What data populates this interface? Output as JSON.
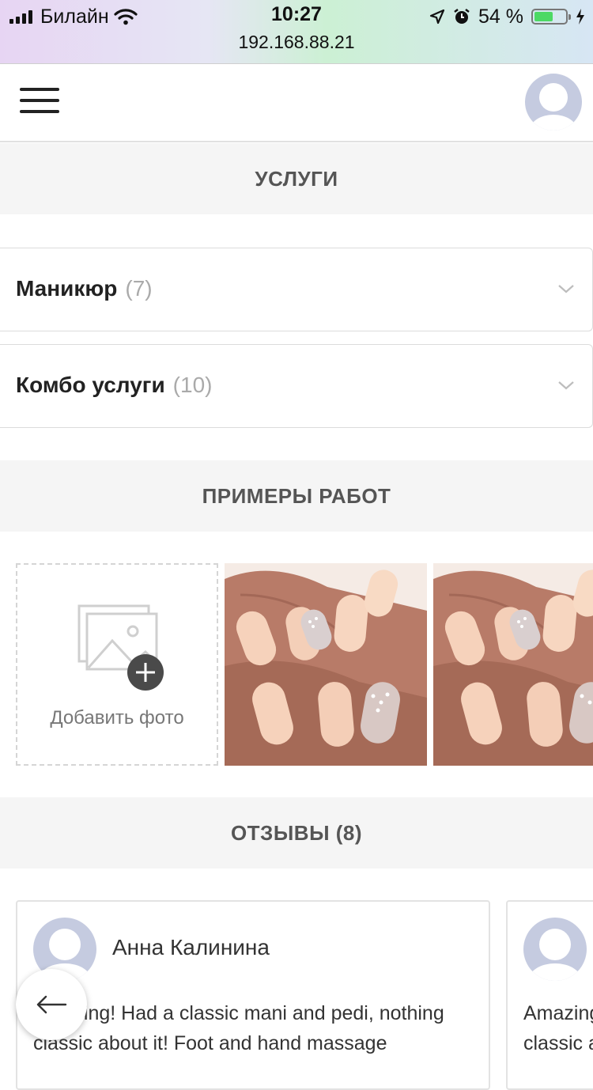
{
  "status_bar": {
    "carrier": "Билайн",
    "time": "10:27",
    "url": "192.168.88.21",
    "battery": "54 %",
    "battery_level": 0.54
  },
  "sections": {
    "services_title": "УСЛУГИ",
    "portfolio_title": "ПРИМЕРЫ РАБОТ",
    "reviews_title": "ОТЗЫВЫ (8)"
  },
  "services": [
    {
      "name": "Маникюр",
      "count": "(7)"
    },
    {
      "name": "Комбо услуги",
      "count": "(10)"
    }
  ],
  "gallery": {
    "add_photo_label": "Добавить фото"
  },
  "reviews": [
    {
      "author": "Анна Калинина",
      "text": "Amazing! Had a classic mani and pedi, nothing classic about it! Foot and hand massage"
    },
    {
      "author": "",
      "text": "Amazing! Had a classic mani and pedi, nothing classic about it!"
    }
  ],
  "icons": {
    "menu": "hamburger-icon",
    "profile": "user-avatar-icon",
    "chevron": "chevron-down-icon",
    "add_photo": "image-add-icon",
    "back": "arrow-left-icon"
  },
  "colors": {
    "section_bg": "#f5f5f5",
    "avatar": "#c5cbe0",
    "battery_fill": "#4cd964"
  }
}
